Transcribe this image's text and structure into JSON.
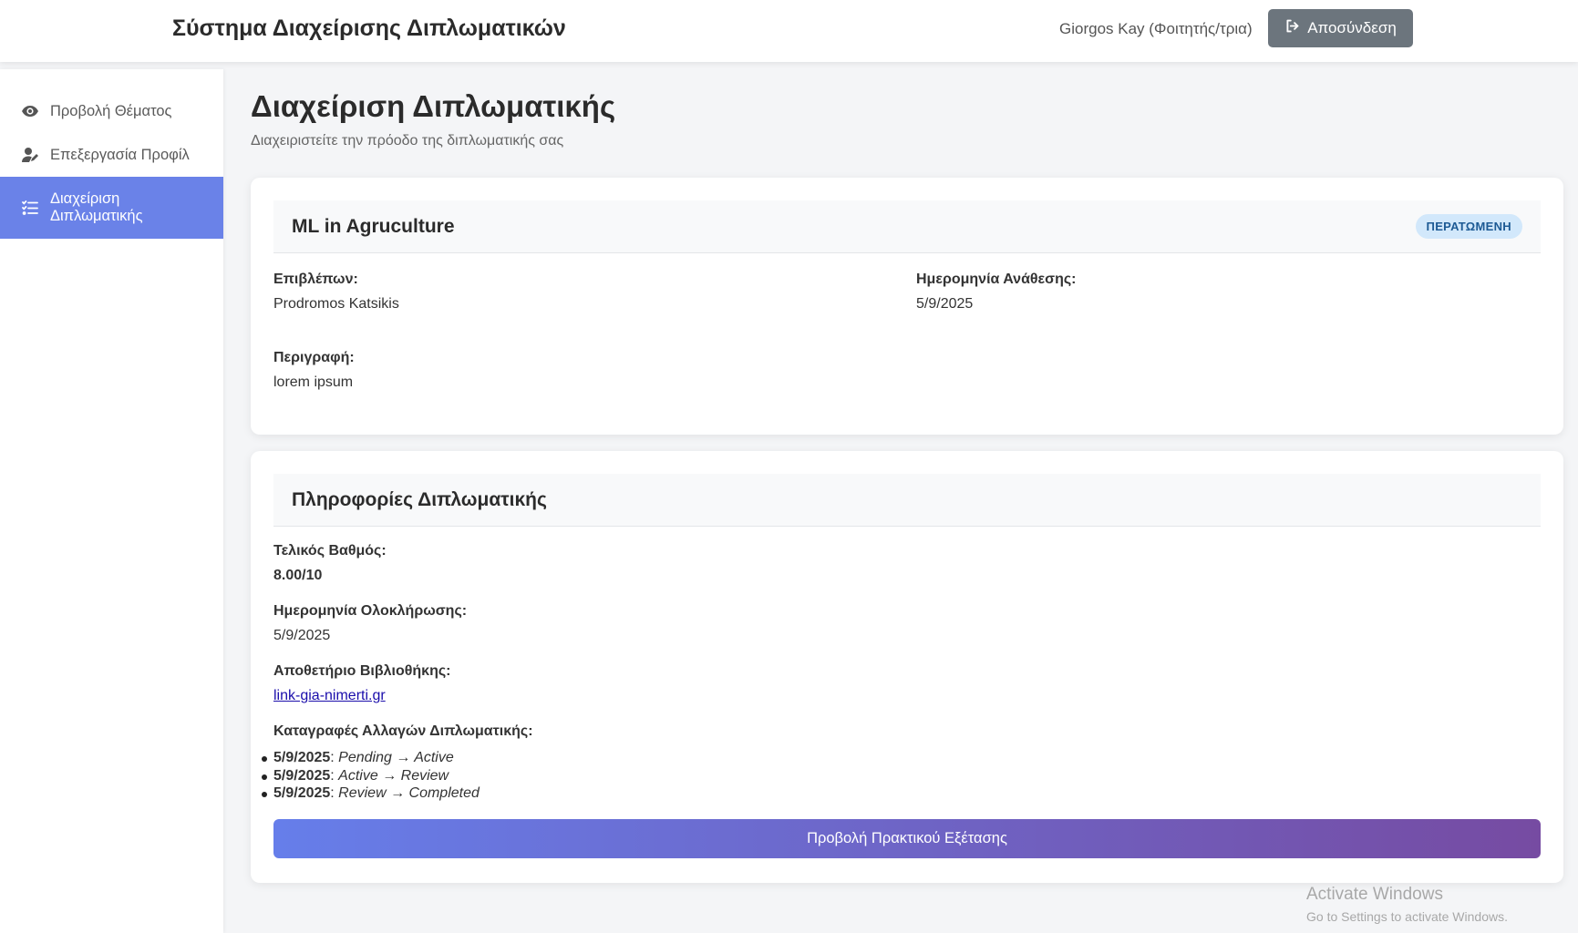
{
  "header": {
    "app_title": "Σύστημα Διαχείρισης Διπλωματικών",
    "user": "Giorgos Kay (Φοιτητής/τρια)",
    "logout_label": "Αποσύνδεση"
  },
  "sidebar": {
    "items": [
      {
        "label": "Προβολή Θέματος",
        "icon": "eye-icon"
      },
      {
        "label": "Επεξεργασία Προφίλ",
        "icon": "user-edit-icon"
      },
      {
        "label": "Διαχείριση Διπλωματικής",
        "icon": "tasks-icon",
        "active": true
      }
    ]
  },
  "page": {
    "title": "Διαχείριση Διπλωματικής",
    "subtitle": "Διαχειριστείτε την πρόοδο της διπλωματικής σας"
  },
  "thesis_card": {
    "title": "ML in Agruculture",
    "status": "ΠΕΡΑΤΩΜΕΝΗ",
    "supervisor_label": "Επιβλέπων:",
    "supervisor": "Prodromos Katsikis",
    "assign_date_label": "Ημερομηνία Ανάθεσης:",
    "assign_date": "5/9/2025",
    "description_label": "Περιγραφή:",
    "description": "lorem ipsum"
  },
  "info_card": {
    "title": "Πληροφορίες Διπλωματικής",
    "grade_label": "Τελικός Βαθμός:",
    "grade": "8.00/10",
    "completion_label": "Ημερομηνία Ολοκλήρωσης:",
    "completion_date": "5/9/2025",
    "repo_label": "Αποθετήριο Βιβλιοθήκης:",
    "repo_link": "link-gia-nimerti.gr",
    "changes_label": "Καταγραφές Αλλαγών Διπλωματικής:",
    "changes": [
      {
        "date": "5/9/2025",
        "transition": "Pending → Active"
      },
      {
        "date": "5/9/2025",
        "transition": "Active → Review"
      },
      {
        "date": "5/9/2025",
        "transition": "Review → Completed"
      }
    ],
    "action_label": "Προβολή Πρακτικού Εξέτασης"
  },
  "watermark": {
    "line1": "Activate Windows",
    "line2": "Go to Settings to activate Windows."
  },
  "colors": {
    "accent": "#6a82e8",
    "gradient_start": "#667eea",
    "gradient_end": "#764ba2",
    "logout_bg": "#6c757d",
    "badge_bg": "#d2e8fb"
  }
}
